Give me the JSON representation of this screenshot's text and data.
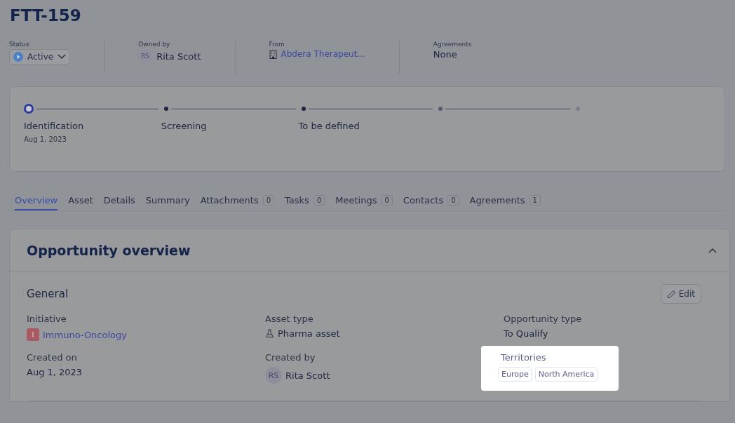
{
  "title": "FTT-159",
  "meta": [
    {
      "kind": "status",
      "label": "Status",
      "value": "Active"
    },
    {
      "kind": "person",
      "label": "Owned by",
      "initials": "RS",
      "value": "Rita Scott"
    },
    {
      "kind": "company",
      "label": "From",
      "value": "Abdera Therapeut..."
    },
    {
      "kind": "text",
      "label": "Agreements",
      "value": "None"
    }
  ],
  "stages": [
    {
      "label": "Identification",
      "date": "Aug 1, 2023",
      "selected": true
    },
    {
      "label": "Screening",
      "selected": false
    },
    {
      "label": "To be defined",
      "selected": false
    },
    {
      "selected": false
    },
    {
      "selected": false
    }
  ],
  "tabs": [
    {
      "label": "Overview",
      "selected": true
    },
    {
      "label": "Asset",
      "selected": false
    },
    {
      "label": "Details",
      "selected": false
    },
    {
      "label": "Summary",
      "selected": false
    },
    {
      "label": "Attachments",
      "count": "0",
      "selected": false
    },
    {
      "label": "Tasks",
      "count": "0",
      "selected": false
    },
    {
      "label": "Meetings",
      "count": "0",
      "selected": false
    },
    {
      "label": "Contacts",
      "count": "0",
      "selected": false
    },
    {
      "label": "Agreements",
      "count": "1",
      "selected": false
    }
  ],
  "section": {
    "title": "Opportunity overview",
    "expanded": true,
    "group": "General",
    "edit_button": "Edit",
    "fields": [
      {
        "kind": "initiative",
        "label": "Initiative",
        "badge": "I",
        "value": "Immuno-Oncology",
        "highlighted": false
      },
      {
        "kind": "asset",
        "label": "Asset type",
        "value": "Pharma asset",
        "highlighted": false
      },
      {
        "kind": "text",
        "label": "Opportunity type",
        "value": "To Qualify",
        "highlighted": false
      },
      {
        "kind": "text",
        "label": "Created on",
        "value": "Aug 1, 2023",
        "highlighted": false
      },
      {
        "kind": "person",
        "label": "Created by",
        "initials": "RS",
        "value": "Rita Scott",
        "highlighted": false
      },
      {
        "kind": "tags",
        "label": "Territories",
        "tags": [
          "Europe",
          "North America"
        ],
        "highlighted": true
      }
    ]
  }
}
